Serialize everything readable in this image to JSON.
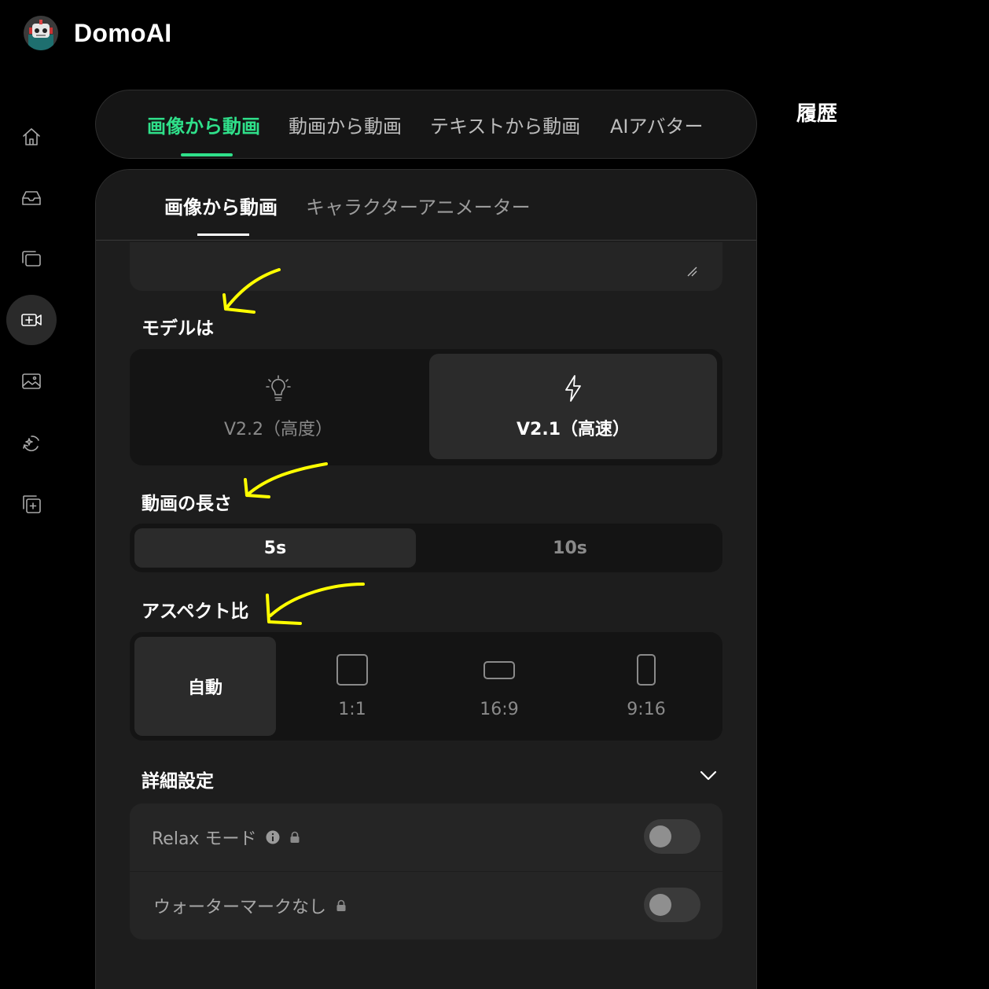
{
  "app": {
    "name": "DomoAI",
    "logo_icon": "robot-logo-icon"
  },
  "sidebar": {
    "items": [
      {
        "name": "home",
        "icon": "home-icon"
      },
      {
        "name": "inbox",
        "icon": "inbox-icon"
      },
      {
        "name": "gallery",
        "icon": "gallery-icon"
      },
      {
        "name": "video",
        "icon": "video-add-icon",
        "active": true
      },
      {
        "name": "image",
        "icon": "image-icon"
      },
      {
        "name": "restyle",
        "icon": "sparkle-loop-icon"
      },
      {
        "name": "collection",
        "icon": "collection-icon"
      }
    ]
  },
  "top_tabs": [
    "画像から動画",
    "動画から動画",
    "テキストから動画",
    "AIアバター"
  ],
  "history_label": "履歴",
  "sub_tabs": [
    "画像から動画",
    "キャラクターアニメーター"
  ],
  "model": {
    "label": "モデルは",
    "options": [
      {
        "label": "V2.2（高度）",
        "icon": "lightbulb-icon"
      },
      {
        "label": "V2.1（高速）",
        "icon": "lightning-icon",
        "selected": true
      }
    ]
  },
  "length": {
    "label": "動画の長さ",
    "options": [
      "5s",
      "10s"
    ],
    "selected": "5s"
  },
  "aspect": {
    "label": "アスペクト比",
    "options": [
      "自動",
      "1:1",
      "16:9",
      "9:16"
    ],
    "selected": "自動"
  },
  "advanced": {
    "label": "詳細設定",
    "relax_label": "Relax モード",
    "relax_on": false,
    "watermark_label": "ウォーターマークなし",
    "watermark_on": false
  },
  "colors": {
    "accent": "#2fe08a",
    "annotation": "#ffff00"
  }
}
